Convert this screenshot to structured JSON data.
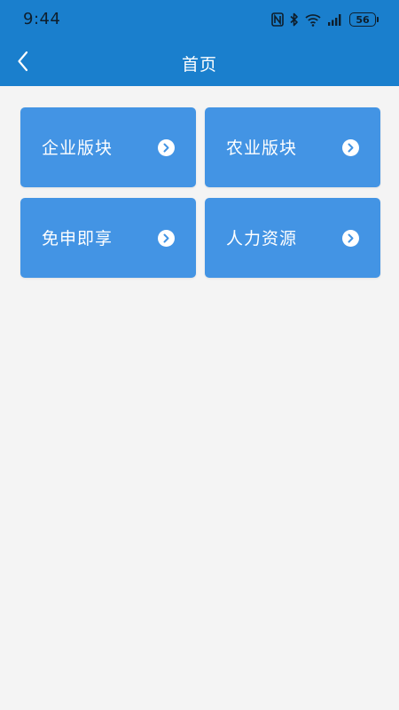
{
  "status_bar": {
    "time": "9:44",
    "battery_level": "56",
    "icons": [
      "nfc-icon",
      "bluetooth-icon",
      "wifi-icon",
      "cellular-signal-icon",
      "battery-icon"
    ]
  },
  "header": {
    "title": "首页",
    "back_icon": "chevron-left-icon",
    "background_color": "#1a7fcd"
  },
  "cards": [
    {
      "label": "企业版块",
      "icon": "chevron-right-circle-icon"
    },
    {
      "label": "农业版块",
      "icon": "chevron-right-circle-icon"
    },
    {
      "label": "免申即享",
      "icon": "chevron-right-circle-icon"
    },
    {
      "label": "人力资源",
      "icon": "chevron-right-circle-icon"
    }
  ],
  "colors": {
    "card": "#4394e4",
    "page_background": "#f4f4f4",
    "text_on_accent": "#ffffff"
  }
}
